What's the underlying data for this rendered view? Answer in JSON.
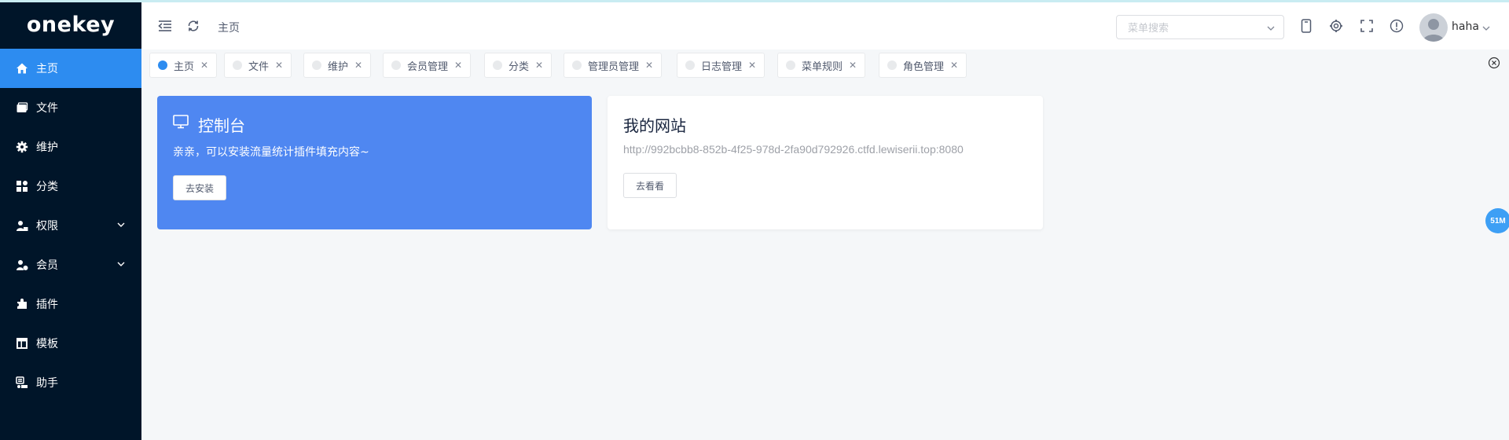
{
  "app": {
    "logo_text": "onekey"
  },
  "sidebar": {
    "items": [
      {
        "label": "主页",
        "icon": "home-icon",
        "active": true
      },
      {
        "label": "文件",
        "icon": "file-icon"
      },
      {
        "label": "维护",
        "icon": "gear-icon"
      },
      {
        "label": "分类",
        "icon": "category-icon"
      },
      {
        "label": "权限",
        "icon": "user-lock-icon",
        "expandable": true
      },
      {
        "label": "会员",
        "icon": "member-icon",
        "expandable": true
      },
      {
        "label": "插件",
        "icon": "puzzle-icon"
      },
      {
        "label": "模板",
        "icon": "template-icon"
      },
      {
        "label": "助手",
        "icon": "assistant-icon"
      }
    ]
  },
  "header": {
    "breadcrumb": "主页",
    "search_placeholder": "菜单搜索",
    "username": "haha"
  },
  "tabs": [
    {
      "label": "主页",
      "active": true
    },
    {
      "label": "文件"
    },
    {
      "label": "维护"
    },
    {
      "label": "会员管理"
    },
    {
      "label": "分类"
    },
    {
      "label": "管理员管理"
    },
    {
      "label": "日志管理"
    },
    {
      "label": "菜单规则"
    },
    {
      "label": "角色管理"
    }
  ],
  "dashboard": {
    "title": "控制台",
    "desc": "亲亲，可以安装流量统计插件填充内容~",
    "button": "去安装"
  },
  "website": {
    "title": "我的网站",
    "url": "http://992bcbb8-852b-4f25-978d-2fa90d792926.ctfd.lewiserii.top:8080",
    "button": "去看看"
  },
  "memory_badge": "51M",
  "colors": {
    "sidebar_bg": "#001529",
    "accent": "#2d8cf0",
    "card_blue": "#4f87f1"
  }
}
